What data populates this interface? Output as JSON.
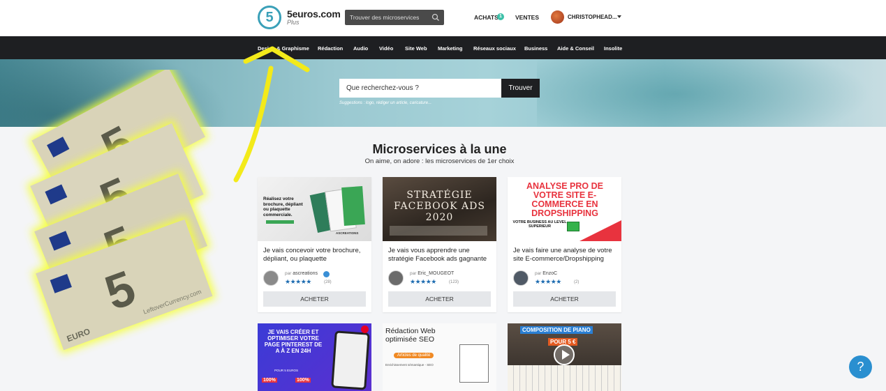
{
  "header": {
    "logo_glyph": "5",
    "brand_name": "5euros.com",
    "brand_sub": "Plus",
    "search_placeholder": "Trouver des microservices",
    "achats_label": "ACHATS",
    "achats_count": "1",
    "ventes_label": "VENTES",
    "user_name": "CHRISTOPHEAD..."
  },
  "categories": [
    "Design & Graphisme",
    "Rédaction",
    "Audio",
    "Vidéo",
    "Site Web",
    "Marketing",
    "Réseaux sociaux",
    "Business",
    "Aide & Conseil",
    "Insolite"
  ],
  "hero": {
    "search_placeholder": "Que recherchez-vous ?",
    "search_button": "Trouver",
    "suggestions": "Suggestions : logo, rédiger un article, caricature..."
  },
  "section": {
    "title": "Microservices à la une",
    "subtitle": "On aime, on adore : les microservices de 1er choix"
  },
  "cards": [
    {
      "title": "Je vais concevoir votre brochure, dépliant, ou plaquette",
      "by": "par",
      "seller": "ascreations",
      "stars": "★★★★★",
      "reviews": "(28)",
      "buy": "ACHETER",
      "image_text": "Réalisez votre brochure, dépliant ou plaquette commerciale.",
      "image_label": "ASCREATIONS"
    },
    {
      "title": "Je vais vous apprendre une stratégie Facebook ads gagnante",
      "by": "par",
      "seller": "Eric_MOUGEOT",
      "stars": "★★★★★",
      "reviews": "(123)",
      "buy": "ACHETER",
      "image_text": "STRATÉGIE FACEBOOK ADS 2020"
    },
    {
      "title": "Je vais faire une analyse de votre site E-commerce/Dropshipping",
      "by": "par",
      "seller": "EnzoC",
      "stars": "★★★★★",
      "reviews": "(2)",
      "buy": "ACHETER",
      "image_text": "ANALYSE PRO DE VOTRE SITE E-COMMERCE EN DROPSHIPPING",
      "image_sub": "VOTRE BUSINESS AU LEVEL SUPERIEUR"
    }
  ],
  "row2": [
    {
      "image_text": "JE VAIS CRÉER ET OPTIMISER VOTRE PAGE PINTEREST DE A À Z EN 24H",
      "image_sub": "POUR 5 EUROS",
      "pct": "100%"
    },
    {
      "image_text": "Rédaction Web optimisée SEO",
      "image_sub": "Articles de qualité",
      "image_sub2": "Enrichissement sémantique - SEO"
    },
    {
      "image_text": "COMPOSITION DE PIANO",
      "image_sub": "POUR 5 €"
    }
  ],
  "overlay": {
    "note_value": "5",
    "note_text": "EURO",
    "watermark": "LeftoverCurrency.com"
  },
  "help": "?",
  "colors": {
    "accent": "#3aa0b8",
    "dark": "#1e1f22",
    "star": "#1c6bb0",
    "badge": "#3cc0a8",
    "help": "#2a8fd0"
  }
}
